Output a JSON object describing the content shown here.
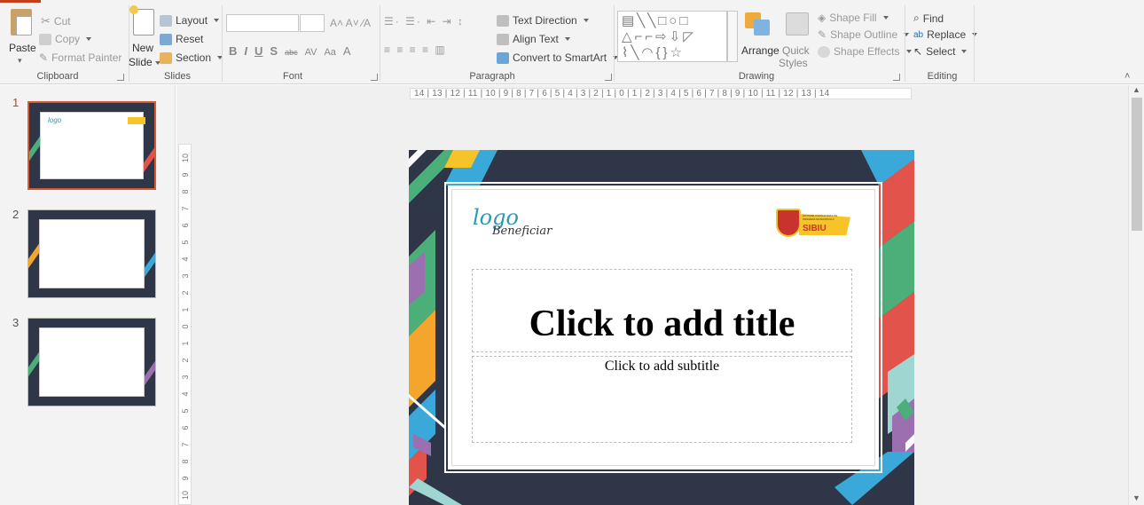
{
  "ribbon": {
    "clipboard": {
      "paste": "Paste",
      "cut": "Cut",
      "copy": "Copy",
      "format_painter": "Format Painter",
      "label": "Clipboard"
    },
    "slides": {
      "new_slide_line1": "New",
      "new_slide_line2": "Slide",
      "layout": "Layout",
      "reset": "Reset",
      "section": "Section",
      "label": "Slides"
    },
    "font": {
      "bold": "B",
      "italic": "I",
      "underline": "U",
      "shadow": "S",
      "strike": "abc",
      "spacing": "AV",
      "case": "Aa",
      "color": "A",
      "label": "Font"
    },
    "paragraph": {
      "text_direction": "Text Direction",
      "align_text": "Align Text",
      "convert_smartart": "Convert to SmartArt",
      "label": "Paragraph"
    },
    "drawing": {
      "arrange": "Arrange",
      "quick_styles_line1": "Quick",
      "quick_styles_line2": "Styles",
      "shape_fill": "Shape Fill",
      "shape_outline": "Shape Outline",
      "shape_effects": "Shape Effects",
      "label": "Drawing"
    },
    "editing": {
      "find": "Find",
      "replace": "Replace",
      "select": "Select",
      "label": "Editing"
    }
  },
  "thumbnails": [
    {
      "number": "1"
    },
    {
      "number": "2"
    },
    {
      "number": "3"
    }
  ],
  "ruler": {
    "horizontal": "14 | 13 | 12 | 11 | 10 | 9 | 8 | 7 | 6 | 5 | 4 | 3 | 2 | 1 | 0 | 1 | 2 | 3 | 4 | 5 | 6 | 7 | 8 | 9 | 10 | 11 | 12 | 13 | 14",
    "vertical": [
      "10",
      "9",
      "8",
      "7",
      "6",
      "5",
      "4",
      "3",
      "2",
      "1",
      "0",
      "1",
      "2",
      "3",
      "4",
      "5",
      "6",
      "7",
      "8",
      "9",
      "10"
    ]
  },
  "slide": {
    "logo_main": "logo",
    "logo_sub": "Beneficiar",
    "sibiu_text": "SIBIU",
    "sibiu_small": "ACTIUNE COFINANTATA DE PRIMARIA MUNICIPIULUI",
    "title_placeholder": "Click to add title",
    "subtitle_placeholder": "Click to add subtitle"
  },
  "colors": {
    "accent": "#c43e1c",
    "slide_dark": "#2e3648",
    "stripe_green": "#4caf7a",
    "stripe_blue": "#3aa8d8",
    "stripe_orange": "#f4a52c",
    "stripe_red": "#e2534b",
    "stripe_purple": "#9b6fb0",
    "stripe_teal": "#9fd6d2",
    "logo_teal": "#2a9bb3",
    "sibiu_yellow": "#f6c429",
    "sibiu_red": "#c8332e"
  }
}
